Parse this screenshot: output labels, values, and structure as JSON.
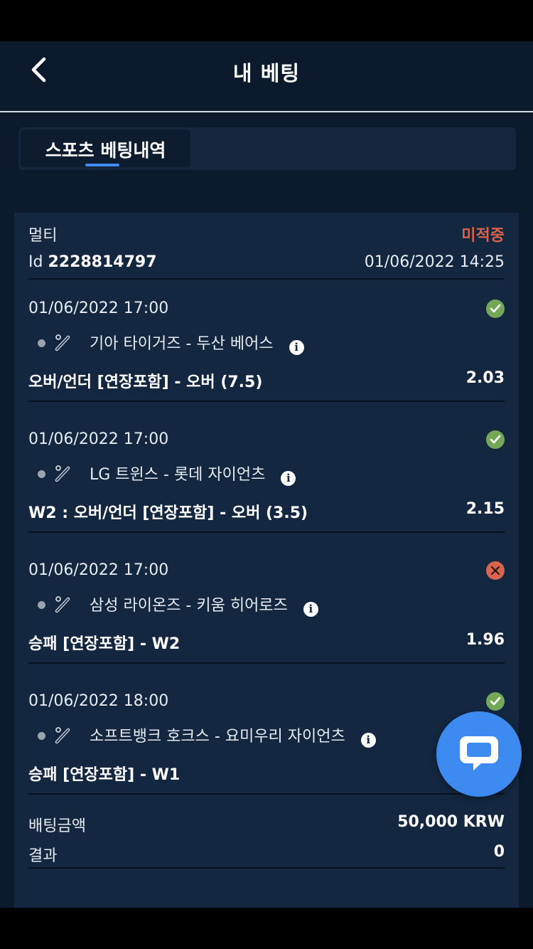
{
  "header": {
    "title": "내 베팅",
    "back_icon": "chevron-left-icon"
  },
  "tabs": [
    {
      "label": "스포츠 베팅내역",
      "active": true
    }
  ],
  "bet": {
    "type": "멀티",
    "status": "미적중",
    "status_color": "#d9624a",
    "id_label": "Id",
    "id_value": "2228814797",
    "date": "01/06/2022 14:25",
    "selections": [
      {
        "time": "01/06/2022 17:00",
        "result": "win",
        "match": "기아 타이거즈 - 두산 베어스",
        "market": "오버/언더 [연장포함] - 오버 (7.5)",
        "odds": "2.03"
      },
      {
        "time": "01/06/2022 17:00",
        "result": "win",
        "match": "LG 트윈스 - 롯데 자이언츠",
        "market": "W2 : 오버/언더 [연장포함] - 오버 (3.5)",
        "odds": "2.15"
      },
      {
        "time": "01/06/2022 17:00",
        "result": "lose",
        "match": "삼성 라이온즈 - 키움 히어로즈",
        "market": "승패 [연장포함] - W2",
        "odds": "1.96"
      },
      {
        "time": "01/06/2022 18:00",
        "result": "win",
        "match": "소프트뱅크 호크스 - 요미우리 자이언츠",
        "market": "승패 [연장포함] - W1",
        "odds": ""
      }
    ],
    "stake_label": "배팅금액",
    "stake_value": "50,000 KRW",
    "result_label": "결과",
    "result_value": "0"
  },
  "colors": {
    "accent": "#3d8bf0",
    "win": "#74a858",
    "lose": "#d76550",
    "background": "#0c1a2e",
    "card": "#132741"
  },
  "chat": {
    "icon": "chat-bubble-icon"
  }
}
